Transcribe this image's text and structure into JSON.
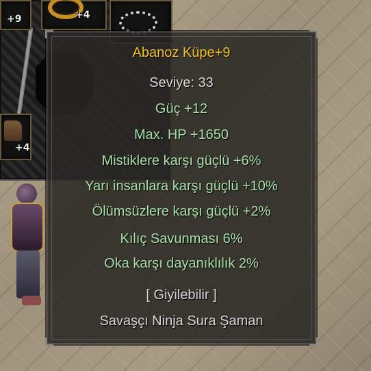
{
  "inventory": {
    "slots": [
      {
        "name": "ring",
        "plus": "+9"
      },
      {
        "name": "ring-gold",
        "plus": "+4"
      },
      {
        "name": "necklace",
        "plus": ""
      },
      {
        "name": "empty",
        "plus": ""
      },
      {
        "name": "boots",
        "plus": "+4"
      }
    ]
  },
  "tooltip": {
    "title": "Abanoz Küpe+9",
    "level": "Seviye: 33",
    "stats": [
      "Güç +12",
      "Max. HP +1650",
      "Mistiklere karşı güçlü +6%",
      "Yarı insanlara karşı güçlü +10%",
      "Ölümsüzlere karşı güçlü +2%",
      "Kılıç Savunması 6%",
      "Oka karşı dayanıklılık 2%"
    ],
    "wearable": "[ Giyilebilir ]",
    "classes": "Savaşçı Ninja Sura Şaman"
  },
  "colors": {
    "title": "#f2c21d",
    "stat": "#a8e0a8",
    "neutral": "#d9d9d9"
  }
}
